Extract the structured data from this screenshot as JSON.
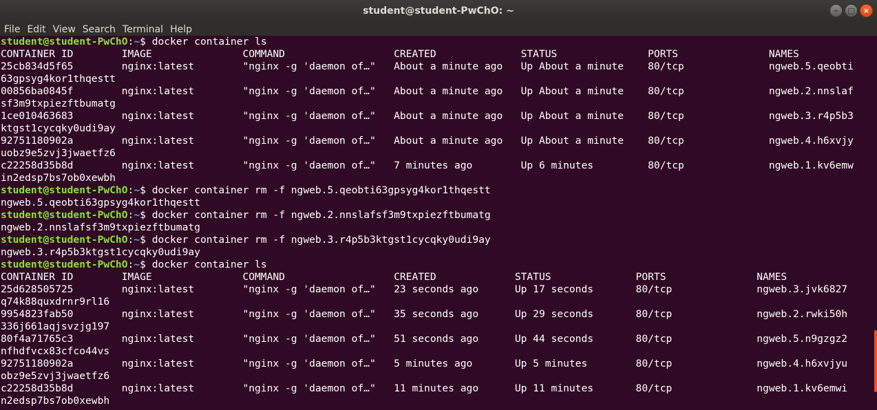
{
  "window": {
    "title": "student@student-PwChO: ~",
    "buttons": {
      "minimize": "–",
      "maximize": "□",
      "close": "×"
    }
  },
  "menubar": [
    "File",
    "Edit",
    "View",
    "Search",
    "Terminal",
    "Help"
  ],
  "prompt": {
    "user_host": "student@student-PwChO",
    "sep": ":",
    "path": "~",
    "dollar": "$ "
  },
  "terminal_lines": [
    {
      "type": "prompt",
      "cmd": "docker container ls"
    },
    {
      "type": "out",
      "text": "CONTAINER ID        IMAGE               COMMAND                  CREATED              STATUS               PORTS               NAMES"
    },
    {
      "type": "out",
      "text": "25cb834d5f65        nginx:latest        \"nginx -g 'daemon of…\"   About a minute ago   Up About a minute    80/tcp              ngweb.5.qeobti"
    },
    {
      "type": "out",
      "text": "63gpsyg4kor1thqestt"
    },
    {
      "type": "out",
      "text": "00856ba0845f        nginx:latest        \"nginx -g 'daemon of…\"   About a minute ago   Up About a minute    80/tcp              ngweb.2.nnslaf"
    },
    {
      "type": "out",
      "text": "sf3m9txpiezftbumatg"
    },
    {
      "type": "out",
      "text": "1ce010463683        nginx:latest        \"nginx -g 'daemon of…\"   About a minute ago   Up About a minute    80/tcp              ngweb.3.r4p5b3"
    },
    {
      "type": "out",
      "text": "ktgst1cycqky0udi9ay"
    },
    {
      "type": "out",
      "text": "92751180902a        nginx:latest        \"nginx -g 'daemon of…\"   About a minute ago   Up About a minute    80/tcp              ngweb.4.h6xvjy"
    },
    {
      "type": "out",
      "text": "uobz9e5zvj3jwaetfz6"
    },
    {
      "type": "out",
      "text": "c22258d35b8d        nginx:latest        \"nginx -g 'daemon of…\"   7 minutes ago        Up 6 minutes         80/tcp              ngweb.1.kv6emw"
    },
    {
      "type": "out",
      "text": "in2edsp7bs7ob0xewbh"
    },
    {
      "type": "prompt",
      "cmd": "docker container rm -f ngweb.5.qeobti63gpsyg4kor1thqestt"
    },
    {
      "type": "out",
      "text": "ngweb.5.qeobti63gpsyg4kor1thqestt"
    },
    {
      "type": "prompt",
      "cmd": "docker container rm -f ngweb.2.nnslafsf3m9txpiezftbumatg"
    },
    {
      "type": "out",
      "text": "ngweb.2.nnslafsf3m9txpiezftbumatg"
    },
    {
      "type": "prompt",
      "cmd": "docker container rm -f ngweb.3.r4p5b3ktgst1cycqky0udi9ay"
    },
    {
      "type": "out",
      "text": "ngweb.3.r4p5b3ktgst1cycqky0udi9ay"
    },
    {
      "type": "prompt",
      "cmd": "docker container ls"
    },
    {
      "type": "out",
      "text": "CONTAINER ID        IMAGE               COMMAND                  CREATED             STATUS              PORTS               NAMES"
    },
    {
      "type": "out",
      "text": "25d628505725        nginx:latest        \"nginx -g 'daemon of…\"   23 seconds ago      Up 17 seconds       80/tcp              ngweb.3.jvk6827"
    },
    {
      "type": "out",
      "text": "q74k88quxdrnr9rl16"
    },
    {
      "type": "out",
      "text": "9954823fab50        nginx:latest        \"nginx -g 'daemon of…\"   35 seconds ago      Up 29 seconds       80/tcp              ngweb.2.rwki50h"
    },
    {
      "type": "out",
      "text": "336j661aqjsvzjg197"
    },
    {
      "type": "out",
      "text": "80f4a71765c3        nginx:latest        \"nginx -g 'daemon of…\"   51 seconds ago      Up 44 seconds       80/tcp              ngweb.5.n9gzgz2"
    },
    {
      "type": "out",
      "text": "nfhdfvcx83cfco44vs"
    },
    {
      "type": "out",
      "text": "92751180902a        nginx:latest        \"nginx -g 'daemon of…\"   5 minutes ago       Up 5 minutes        80/tcp              ngweb.4.h6xvjyu"
    },
    {
      "type": "out",
      "text": "obz9e5zvj3jwaetfz6"
    },
    {
      "type": "out",
      "text": "c22258d35b8d        nginx:latest        \"nginx -g 'daemon of…\"   11 minutes ago      Up 11 minutes       80/tcp              ngweb.1.kv6emwi"
    },
    {
      "type": "out",
      "text": "n2edsp7bs7ob0xewbh"
    }
  ],
  "colors": {
    "background": "#300a24",
    "prompt_user": "#8ae234",
    "prompt_path": "#729fcf",
    "text": "#ffffff"
  }
}
